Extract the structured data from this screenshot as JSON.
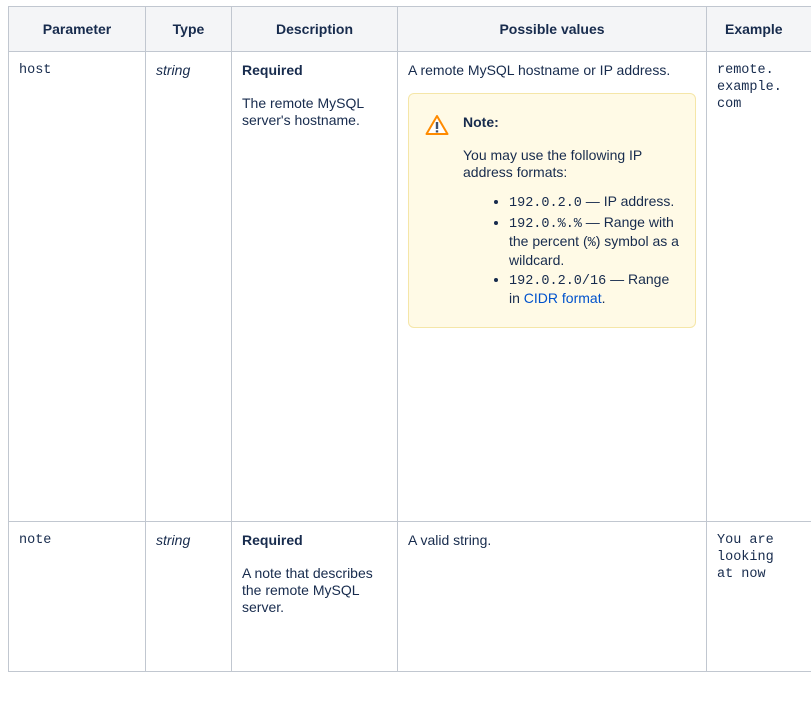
{
  "headers": [
    "Parameter",
    "Type",
    "Description",
    "Possible values",
    "Example"
  ],
  "rows": [
    {
      "parameter": "host",
      "type": "string",
      "required": "Required",
      "description": "The remote MySQL server's hostname.",
      "possible": "A remote MySQL hostname or IP address.",
      "example": "remote.\nexample.\ncom"
    },
    {
      "parameter": "note",
      "type": "string",
      "required": "Required",
      "description": "A note that describes the remote MySQL server.",
      "possible": "A valid string.",
      "example": "You are\nlooking\nat now"
    }
  ],
  "note": {
    "icon": "warning-icon",
    "title": "Note:",
    "intro": "You may use the following IP address formats:",
    "items": [
      {
        "code": "192.0.2.0",
        "text": " — IP address."
      },
      {
        "code": "192.0.%.%",
        "text": " — Range with the percent (",
        "code2": "%",
        "text2": ") symbol as a wildcard."
      },
      {
        "code": "192.0.2.0/16",
        "text": " — Range in ",
        "link": "CIDR format",
        "text2": "."
      }
    ]
  },
  "colors": {
    "note_bg": "#fffae6",
    "link": "#0052cc",
    "header_bg": "#f4f5f7",
    "warning": "#ff8b00"
  }
}
